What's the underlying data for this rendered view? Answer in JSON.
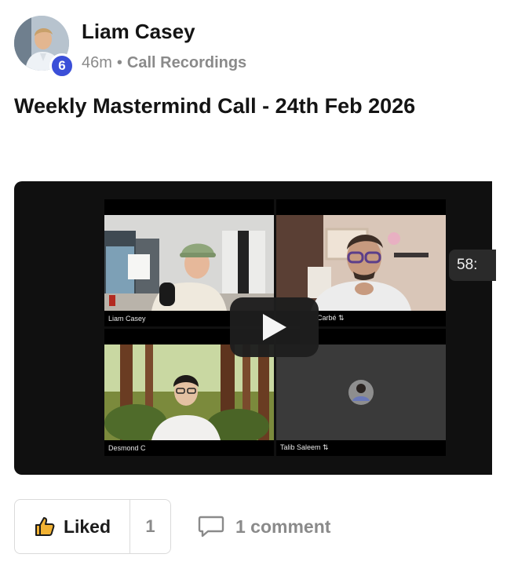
{
  "author": {
    "name": "Liam Casey",
    "level": "6"
  },
  "post": {
    "time": "46m",
    "separator": "•",
    "category": "Call Recordings",
    "title": "Weekly Mastermind Call - 24th Feb 2026"
  },
  "video": {
    "participants": [
      {
        "label": "Liam Casey"
      },
      {
        "label": "Carbé ⇅"
      },
      {
        "label": "Desmond C"
      },
      {
        "label": "Talib Saleem ⇅"
      }
    ],
    "duration": "58:"
  },
  "actions": {
    "like_label": "Liked",
    "like_count": "1",
    "comment_label": "1 comment"
  },
  "colors": {
    "badge": "#3b4fd8",
    "muted": "#8a8a8a",
    "text": "#141414"
  }
}
